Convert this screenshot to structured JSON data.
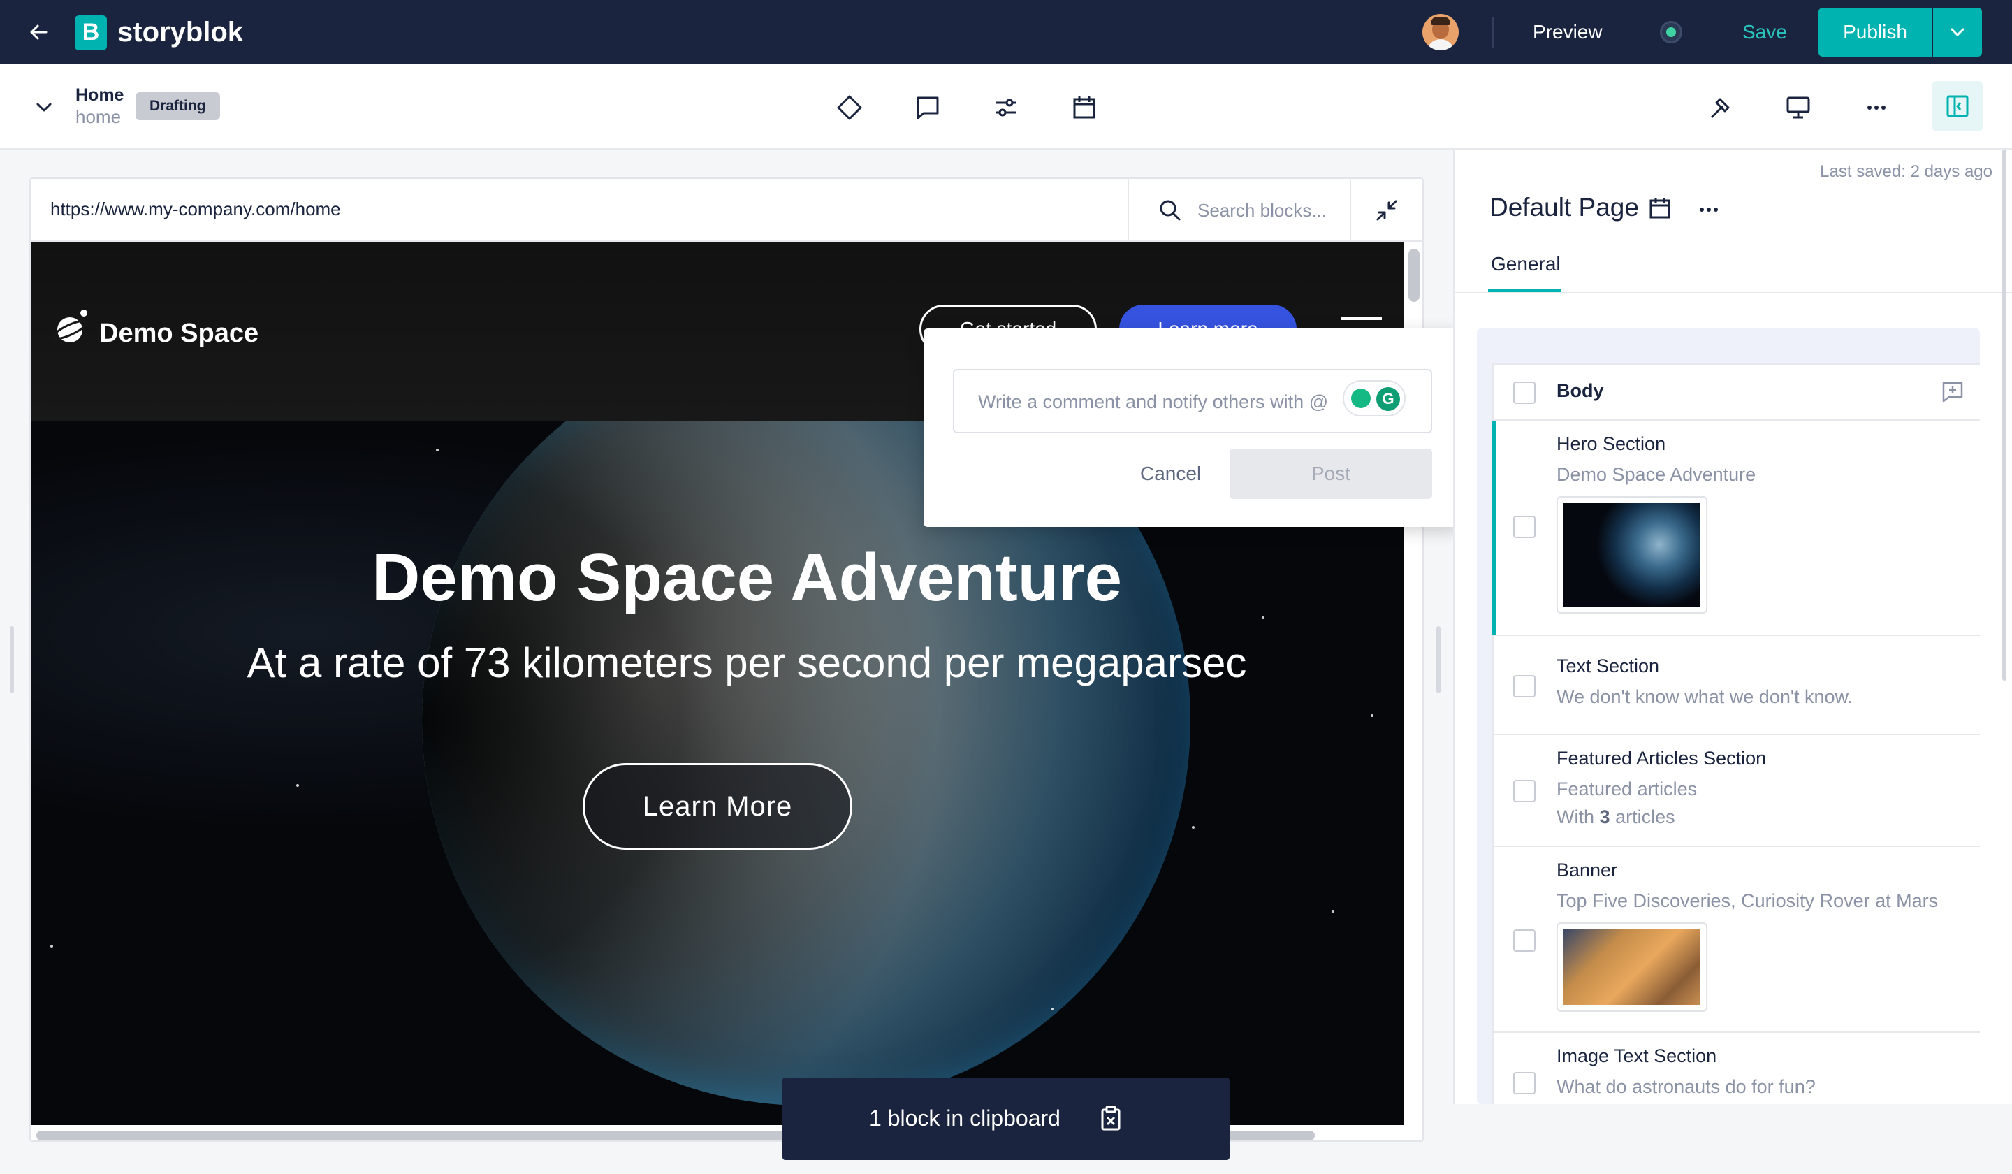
{
  "app": {
    "name": "storyblok",
    "logo_letter": "B"
  },
  "topbar": {
    "preview_label": "Preview",
    "save_label": "Save",
    "publish_label": "Publish"
  },
  "story": {
    "name": "Home",
    "slug": "home",
    "status": "Drafting"
  },
  "preview": {
    "url": "https://www.my-company.com/home",
    "search_placeholder": "Search blocks...",
    "site_title": "Demo Space",
    "header_button_1": "Get started",
    "header_button_2": "Learn more",
    "hero_title": "Demo Space Adventure",
    "hero_subtitle": "At a rate of 73 kilometers per second per megaparsec",
    "hero_button": "Learn More"
  },
  "comment": {
    "placeholder": "Write a comment and notify others with @",
    "cancel_label": "Cancel",
    "post_label": "Post"
  },
  "clipboard": {
    "text": "1 block in clipboard"
  },
  "panel": {
    "last_saved": "Last saved: 2 days ago",
    "title": "Default Page",
    "tab": "General",
    "field": "Body",
    "blocks": [
      {
        "title": "Hero Section",
        "subtitle": "Demo Space Adventure"
      },
      {
        "title": "Text Section",
        "subtitle": "We don't know what we don't know."
      },
      {
        "title": "Featured Articles Section",
        "subtitle": "Featured articles",
        "extra_prefix": "With",
        "extra_count": "3",
        "extra_suffix": "articles"
      },
      {
        "title": "Banner",
        "subtitle": "Top Five Discoveries, Curiosity Rover at Mars"
      },
      {
        "title": "Image Text Section",
        "subtitle": "What do astronauts do for fun?"
      }
    ]
  },
  "colors": {
    "brand": "#00b3b0",
    "topbar": "#1b243f",
    "status_dot": "#3fd2a3",
    "accent_blue": "#3653e0"
  },
  "icons": {
    "back": "arrow-left-icon",
    "chevron": "chevron-down-icon",
    "tools": [
      "diamond-icon",
      "comment-icon",
      "sliders-icon",
      "calendar-icon"
    ],
    "right_tools": [
      "hammer-icon",
      "monitor-icon",
      "more-horizontal-icon",
      "sidebar-toggle-icon"
    ]
  }
}
